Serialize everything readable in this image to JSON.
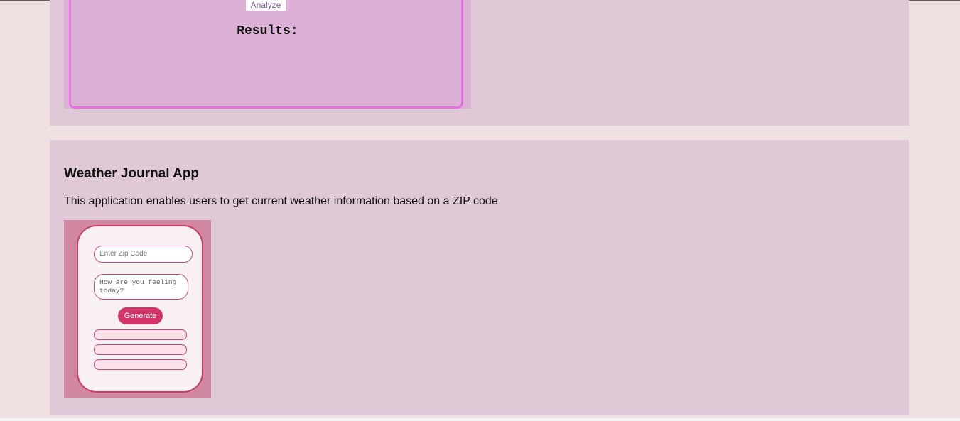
{
  "sentiment_project": {
    "analyze_button": "Analyze",
    "results_label": "Results:"
  },
  "weather_project": {
    "title": "Weather Journal App",
    "description": "This application enables users to get current weather information based on a ZIP code",
    "preview": {
      "zip_placeholder": "Enter Zip Code",
      "feeling_placeholder": "How are you feeling today?",
      "generate_button": "Generate"
    }
  },
  "colors": {
    "page_background": "#efe1e1",
    "card_background": "#e0c9d6",
    "accent_pink": "#d33467"
  }
}
